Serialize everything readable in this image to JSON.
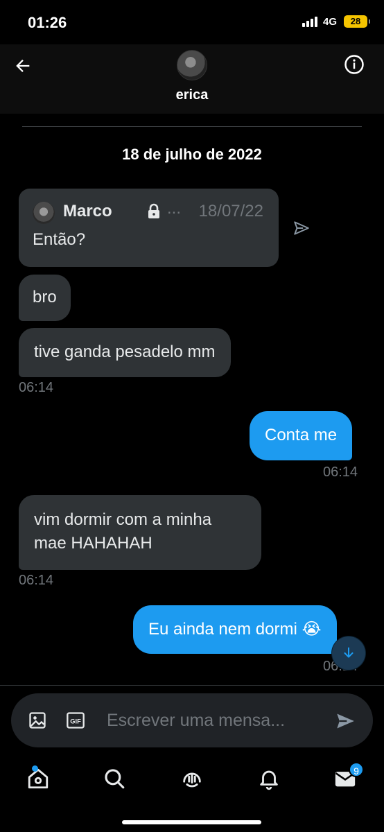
{
  "status_bar": {
    "time": "01:26",
    "network": "4G",
    "battery": "28"
  },
  "header": {
    "contact_name": "erica"
  },
  "conversation": {
    "date_separator": "18 de julho de 2022",
    "quoted_tweet": {
      "author": "Marco",
      "ellipsis": "...",
      "date": "18/07/22",
      "text": "Então?"
    },
    "messages": [
      {
        "direction": "in",
        "text": "bro"
      },
      {
        "direction": "in",
        "text": "tive ganda pesadelo mm",
        "time": "06:14"
      },
      {
        "direction": "out",
        "text": "Conta me",
        "time": "06:14"
      },
      {
        "direction": "in",
        "text": "vim dormir com a minha mae HAHAHAH",
        "time": "06:14"
      },
      {
        "direction": "out",
        "text": "Eu ainda nem dormi 😭",
        "time": "06:14"
      }
    ]
  },
  "composer": {
    "placeholder": "Escrever uma mensa..."
  },
  "tab_bar": {
    "messages_badge": "9"
  },
  "colors": {
    "accent": "#1d9bf0",
    "incoming_bubble": "#2f3336",
    "muted_text": "#71767b"
  }
}
